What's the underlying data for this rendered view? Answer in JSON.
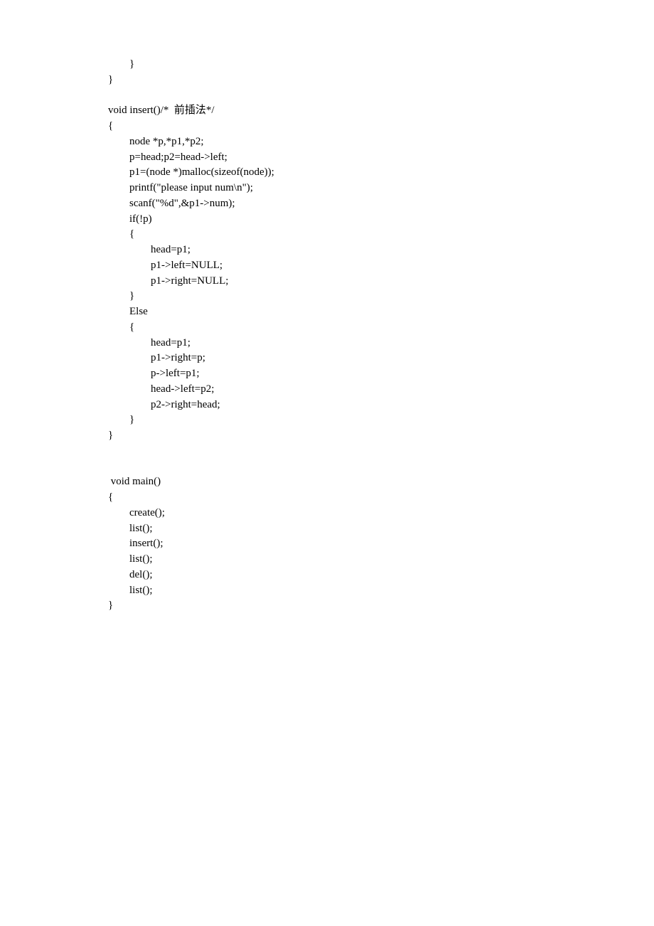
{
  "code": {
    "lines": [
      "        }",
      "}",
      "",
      "void insert()/*  前插法*/",
      "{",
      "        node *p,*p1,*p2;",
      "        p=head;p2=head->left;",
      "        p1=(node *)malloc(sizeof(node));",
      "        printf(\"please input num\\n\");",
      "        scanf(\"%d\",&p1->num);",
      "        if(!p)",
      "        {",
      "                head=p1;",
      "                p1->left=NULL;",
      "                p1->right=NULL;",
      "        }",
      "        Else",
      "        {",
      "                head=p1;",
      "                p1->right=p;",
      "                p->left=p1;",
      "                head->left=p2;",
      "                p2->right=head;",
      "        }",
      "}",
      "",
      "",
      " void main()",
      "{",
      "        create();",
      "        list();",
      "        insert();",
      "        list();",
      "        del();",
      "        list();",
      "}"
    ]
  }
}
